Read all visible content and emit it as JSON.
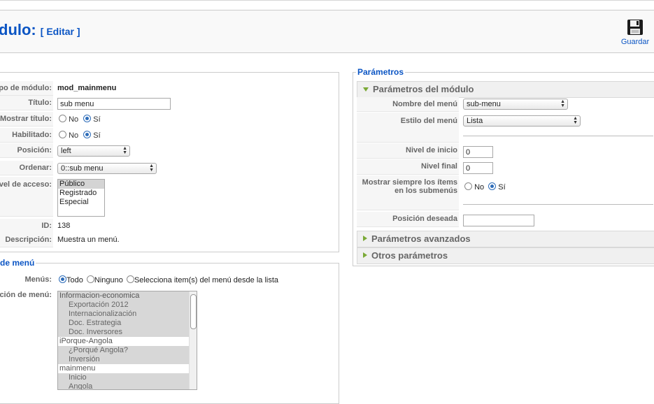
{
  "header": {
    "title": "dulo:",
    "edit_label": "[ Editar ]",
    "save_label": "Guardar"
  },
  "details": {
    "type_label": "po de módulo:",
    "type_value": "mod_mainmenu",
    "title_label": "Título:",
    "title_value": "sub menu",
    "show_title_label": "Mostrar título:",
    "no_label": "No",
    "yes_label": "Sí",
    "enabled_label": "Habilitado:",
    "position_label": "Posición:",
    "position_value": "left",
    "order_label": "Ordenar:",
    "order_value": "0::sub menu",
    "access_label": "vel de acceso:",
    "access_options": [
      "Público",
      "Registrado",
      "Especial"
    ],
    "id_label": "ID:",
    "id_value": "138",
    "desc_label": "Descripción:",
    "desc_value": "Muestra un menú."
  },
  "menu_assignment": {
    "legend": "de menú",
    "menus_label": "Menús:",
    "opt_all": "Todo",
    "opt_none": "Ninguno",
    "opt_select": "Selecciona item(s) del menú desde la lista",
    "selection_label": "ción de menú:",
    "items": [
      "Informacion-economica",
      "Exportación 2012",
      "Internacionalización",
      "Doc. Estrategia",
      "Doc. Inversores",
      "iPorque-Angola",
      "¿Porqué Angola?",
      "Inversión",
      "mainmenu",
      "Inicio",
      "Angola"
    ]
  },
  "params": {
    "legend": "Parámetros",
    "module_section": "Parámetros del módulo",
    "menu_name_label": "Nombre del menú",
    "menu_name_value": "sub-menu",
    "menu_style_label": "Estilo del menú",
    "menu_style_value": "Lista",
    "start_level_label": "Nivel de inicio",
    "start_level_value": "0",
    "end_level_label": "Nivel final",
    "end_level_value": "0",
    "always_show_label_1": "Mostrar siempre los ítems",
    "always_show_label_2": "en los submenús",
    "no_label": "No",
    "yes_label": "Sí",
    "desired_position_label": "Posición deseada",
    "desired_position_value": "",
    "advanced_section": "Parámetros avanzados",
    "other_section": "Otros parámetros"
  },
  "colors": {
    "link_blue": "#0b55c4",
    "accent_green": "#7aa936"
  }
}
